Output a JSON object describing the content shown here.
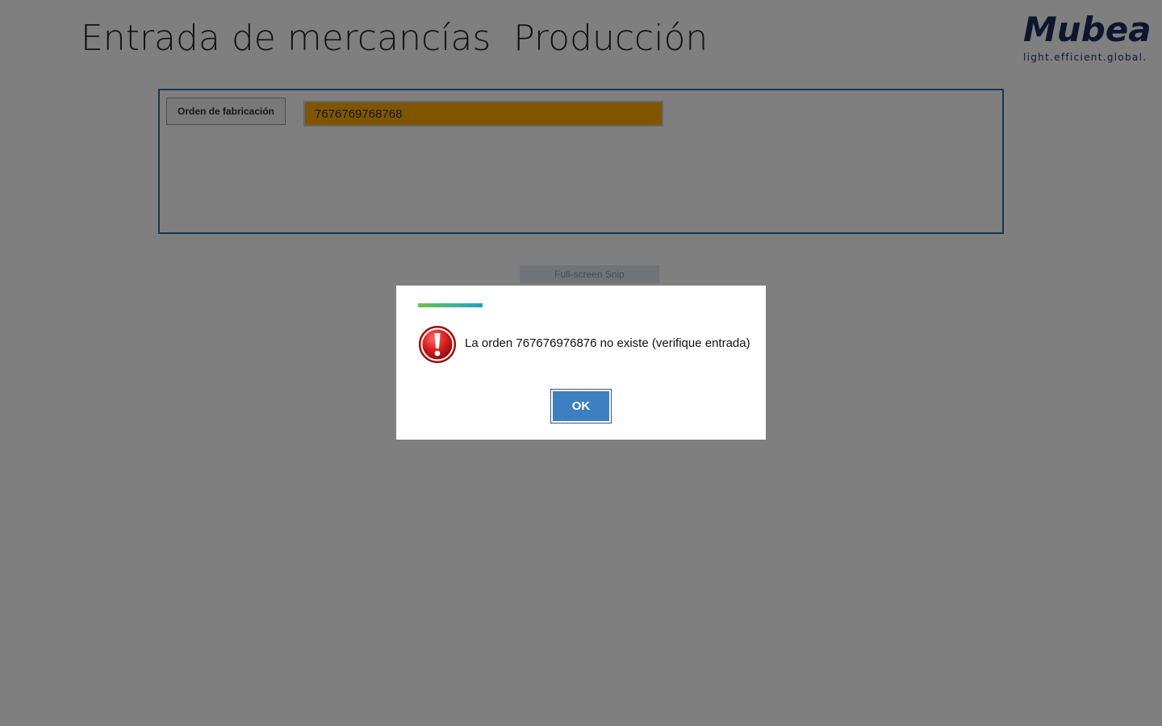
{
  "header": {
    "title": "Entrada de mercancías  Producción"
  },
  "logo": {
    "word": "Mubea",
    "tagline": "light.efficient.global.",
    "color": "#1c2d5e"
  },
  "form": {
    "order_label": "Orden de fabricación",
    "order_value": "7676769768768",
    "input_bg_color": "#ffaa00",
    "panel_border_color": "#2e6fb5"
  },
  "overlay_hint": {
    "text": "Full-screen Snip"
  },
  "dialog": {
    "icon": "error-icon",
    "message": "La orden 767676976876 no existe (verifique entrada)",
    "ok_label": "OK",
    "button_color": "#3d7fc1"
  }
}
